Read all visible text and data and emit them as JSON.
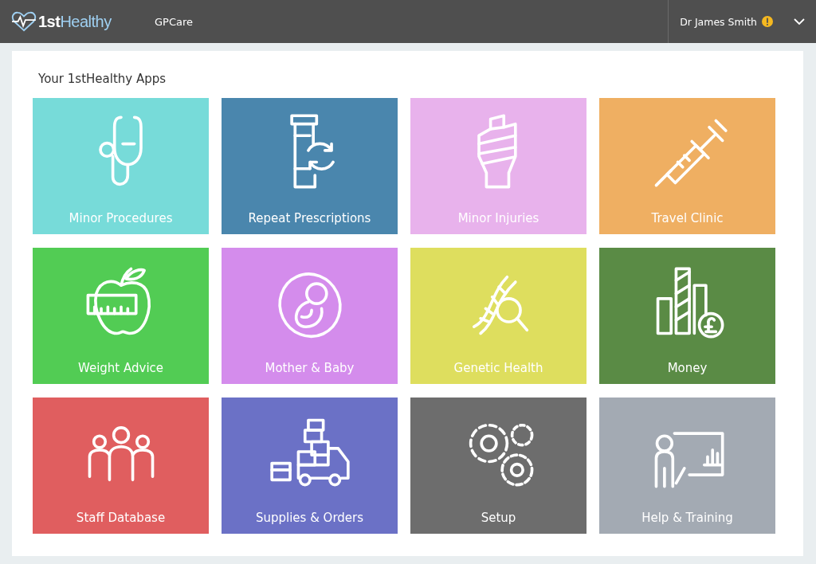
{
  "header": {
    "logo": {
      "part_1": "1st",
      "part_2": "Healthy"
    },
    "app_name": "GPCare",
    "user": {
      "name": "Dr James Smith",
      "warning": true
    }
  },
  "section_title": "Your 1stHealthy Apps",
  "tiles": [
    {
      "label": "Minor Procedures",
      "color": "#77dbd9",
      "kind": "stethoscope"
    },
    {
      "label": "Repeat Prescriptions",
      "color": "#4a86ad",
      "kind": "prescription"
    },
    {
      "label": "Minor Injuries",
      "color": "#e8b2ec",
      "kind": "bandage"
    },
    {
      "label": "Travel Clinic",
      "color": "#efaf62",
      "kind": "syringe"
    },
    {
      "label": "Weight Advice",
      "color": "#52cc54",
      "kind": "apple"
    },
    {
      "label": "Mother & Baby",
      "color": "#d48cec",
      "kind": "baby"
    },
    {
      "label": "Genetic Health",
      "color": "#dede5e",
      "kind": "dna"
    },
    {
      "label": "Money",
      "color": "#5a8b45",
      "kind": "money"
    },
    {
      "label": "Staff Database",
      "color": "#e05e5f",
      "kind": "people"
    },
    {
      "label": "Supplies & Orders",
      "color": "#6b71c6",
      "kind": "truck"
    },
    {
      "label": "Setup",
      "color": "#6d6d6d",
      "kind": "gears"
    },
    {
      "label": "Help & Training",
      "color": "#a3aab3",
      "kind": "training"
    }
  ]
}
